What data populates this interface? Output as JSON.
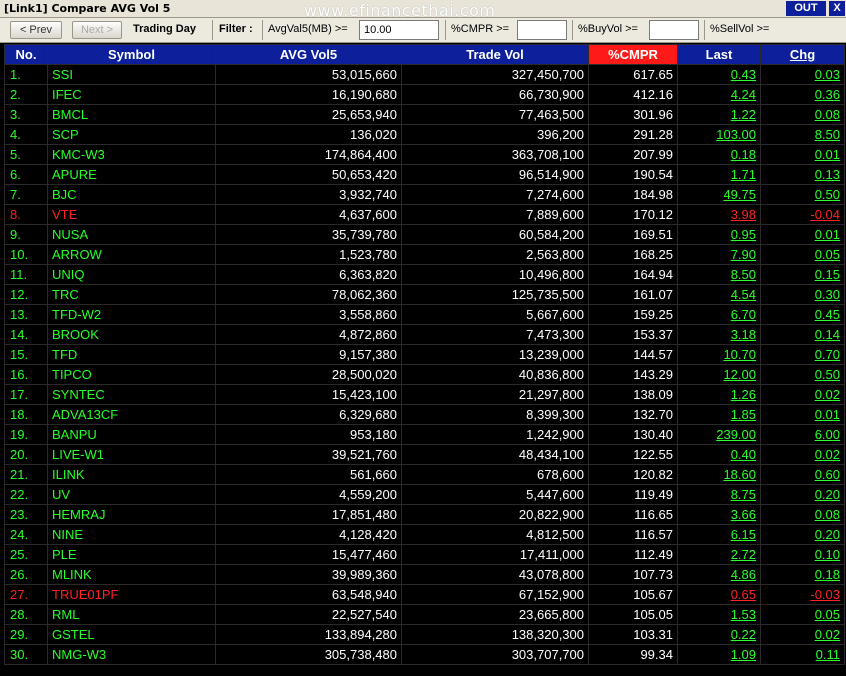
{
  "window": {
    "title": "[Link1] Compare AVG Vol 5",
    "watermark": "www.efinancethai.com",
    "out_label": "OUT",
    "close_label": "X"
  },
  "toolbar": {
    "prev_label": "< Prev",
    "next_label": "Next >",
    "trading_day_label": "Trading Day",
    "filter_label": "Filter :",
    "avgvol_label": "AvgVal5(MB) >=",
    "avgvol_value": "10.00",
    "cmpr_label": "%CMPR >=",
    "cmpr_value": "",
    "buyvol_label": "%BuyVol >=",
    "buyvol_value": "",
    "sellvol_label": "%SellVol >="
  },
  "table": {
    "headers": [
      "No.",
      "Symbol",
      "AVG Vol5",
      "Trade Vol",
      "%CMPR",
      "Last",
      "Chg"
    ],
    "rows": [
      [
        "1.",
        "SSI",
        "53,015,660",
        "327,450,700",
        "617.65",
        "0.43",
        "0.03"
      ],
      [
        "2.",
        "IFEC",
        "16,190,680",
        "66,730,900",
        "412.16",
        "4.24",
        "0.36"
      ],
      [
        "3.",
        "BMCL",
        "25,653,940",
        "77,463,500",
        "301.96",
        "1.22",
        "0.08"
      ],
      [
        "4.",
        "SCP",
        "136,020",
        "396,200",
        "291.28",
        "103.00",
        "8.50"
      ],
      [
        "5.",
        "KMC-W3",
        "174,864,400",
        "363,708,100",
        "207.99",
        "0.18",
        "0.01"
      ],
      [
        "6.",
        "APURE",
        "50,653,420",
        "96,514,900",
        "190.54",
        "1.71",
        "0.13"
      ],
      [
        "7.",
        "BJC",
        "3,932,740",
        "7,274,600",
        "184.98",
        "49.75",
        "0.50"
      ],
      [
        "8.",
        "VTE",
        "4,637,600",
        "7,889,600",
        "170.12",
        "3.98",
        "-0.04"
      ],
      [
        "9.",
        "NUSA",
        "35,739,780",
        "60,584,200",
        "169.51",
        "0.95",
        "0.01"
      ],
      [
        "10.",
        "ARROW",
        "1,523,780",
        "2,563,800",
        "168.25",
        "7.90",
        "0.05"
      ],
      [
        "11.",
        "UNIQ",
        "6,363,820",
        "10,496,800",
        "164.94",
        "8.50",
        "0.15"
      ],
      [
        "12.",
        "TRC",
        "78,062,360",
        "125,735,500",
        "161.07",
        "4.54",
        "0.30"
      ],
      [
        "13.",
        "TFD-W2",
        "3,558,860",
        "5,667,600",
        "159.25",
        "6.70",
        "0.45"
      ],
      [
        "14.",
        "BROOK",
        "4,872,860",
        "7,473,300",
        "153.37",
        "3.18",
        "0.14"
      ],
      [
        "15.",
        "TFD",
        "9,157,380",
        "13,239,000",
        "144.57",
        "10.70",
        "0.70"
      ],
      [
        "16.",
        "TIPCO",
        "28,500,020",
        "40,836,800",
        "143.29",
        "12.00",
        "0.50"
      ],
      [
        "17.",
        "SYNTEC",
        "15,423,100",
        "21,297,800",
        "138.09",
        "1.26",
        "0.02"
      ],
      [
        "18.",
        "ADVA13CF",
        "6,329,680",
        "8,399,300",
        "132.70",
        "1.85",
        "0.01"
      ],
      [
        "19.",
        "BANPU",
        "953,180",
        "1,242,900",
        "130.40",
        "239.00",
        "6.00"
      ],
      [
        "20.",
        "LIVE-W1",
        "39,521,760",
        "48,434,100",
        "122.55",
        "0.40",
        "0.02"
      ],
      [
        "21.",
        "ILINK",
        "561,660",
        "678,600",
        "120.82",
        "18.60",
        "0.60"
      ],
      [
        "22.",
        "UV",
        "4,559,200",
        "5,447,600",
        "119.49",
        "8.75",
        "0.20"
      ],
      [
        "23.",
        "HEMRAJ",
        "17,851,480",
        "20,822,900",
        "116.65",
        "3.66",
        "0.08"
      ],
      [
        "24.",
        "NINE",
        "4,128,420",
        "4,812,500",
        "116.57",
        "6.15",
        "0.20"
      ],
      [
        "25.",
        "PLE",
        "15,477,460",
        "17,411,000",
        "112.49",
        "2.72",
        "0.10"
      ],
      [
        "26.",
        "MLINK",
        "39,989,360",
        "43,078,800",
        "107.73",
        "4.86",
        "0.18"
      ],
      [
        "27.",
        "TRUE01PF",
        "63,548,940",
        "67,152,900",
        "105.67",
        "0.65",
        "-0.03"
      ],
      [
        "28.",
        "RML",
        "22,527,540",
        "23,665,800",
        "105.05",
        "1.53",
        "0.05"
      ],
      [
        "29.",
        "GSTEL",
        "133,894,280",
        "138,320,300",
        "103.31",
        "0.22",
        "0.02"
      ],
      [
        "30.",
        "NMG-W3",
        "305,738,480",
        "303,707,700",
        "99.34",
        "1.09",
        "0.11"
      ]
    ]
  },
  "colors": {
    "header_bg": "#0d1f9a",
    "cmpr_header_bg": "#ff1a1a",
    "positive": "#29ff29",
    "negative": "#ff2222"
  }
}
